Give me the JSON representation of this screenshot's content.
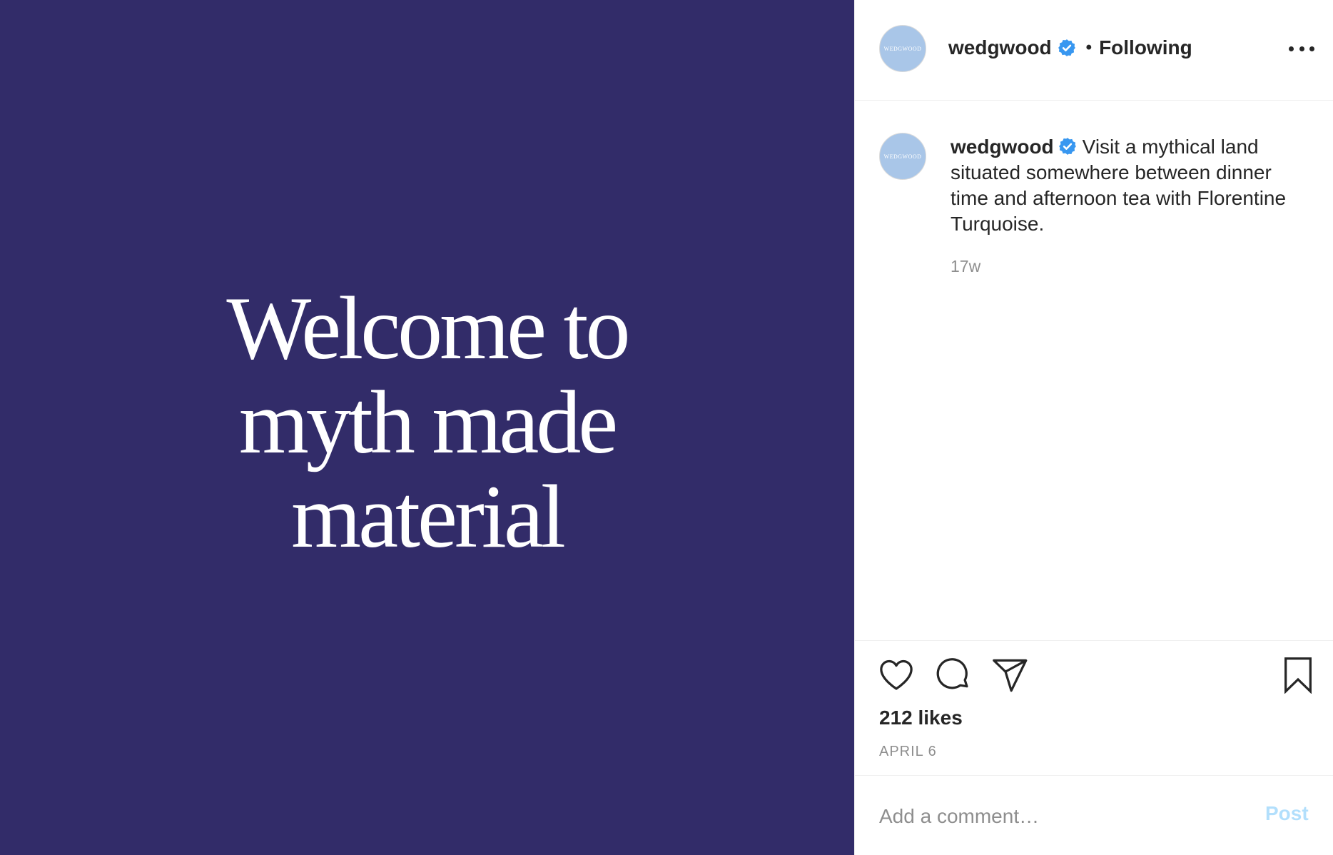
{
  "post_image": {
    "headline_lines": [
      "Welcome to",
      "myth made",
      "material"
    ],
    "background_color": "#322c69",
    "text_color": "#ffffff"
  },
  "header": {
    "avatar_text": "WEDGWOOD",
    "username": "wedgwood",
    "verified_icon": "verified-badge-icon",
    "separator": "•",
    "follow_status": "Following",
    "more_icon": "more-options-icon"
  },
  "caption": {
    "avatar_text": "WEDGWOOD",
    "username": "wedgwood",
    "text": "Visit a mythical land situated somewhere between dinner time and afternoon tea with Florentine Turquoise.",
    "timestamp": "17w"
  },
  "actions": {
    "like_icon": "heart-icon",
    "comment_icon": "comment-icon",
    "share_icon": "paper-plane-icon",
    "save_icon": "bookmark-icon"
  },
  "likes": "212 likes",
  "date": "APRIL 6",
  "comment_box": {
    "placeholder": "Add a comment…",
    "post_label": "Post"
  },
  "colors": {
    "verified": "#3897f0",
    "post_button_disabled": "#b2dffc",
    "avatar_bg": "#a9c6e8"
  }
}
